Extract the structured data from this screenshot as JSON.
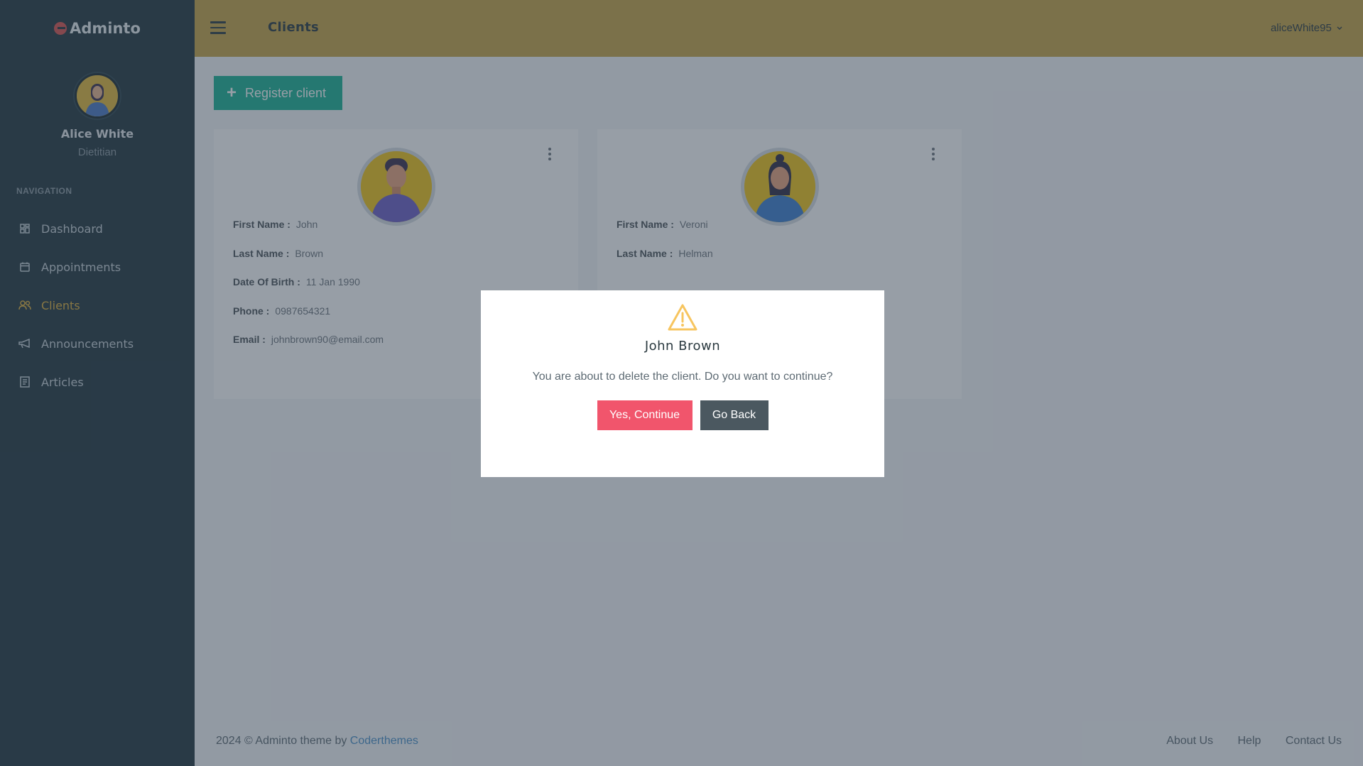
{
  "app": {
    "logo_text": "Adminto"
  },
  "user": {
    "name": "Alice White",
    "role": "Dietitian",
    "username": "aliceWhite95"
  },
  "nav": {
    "title": "NAVIGATION",
    "items": [
      {
        "label": "Dashboard",
        "icon": "grid-icon"
      },
      {
        "label": "Appointments",
        "icon": "calendar-icon"
      },
      {
        "label": "Clients",
        "icon": "users-icon",
        "active": true
      },
      {
        "label": "Announcements",
        "icon": "megaphone-icon"
      },
      {
        "label": "Articles",
        "icon": "document-icon"
      }
    ]
  },
  "header": {
    "title": "Clients"
  },
  "toolbar": {
    "register_label": "Register client",
    "register_icon": "+"
  },
  "labels": {
    "first_name": "First Name :",
    "last_name": "Last Name :",
    "dob": "Date Of Birth :",
    "phone": "Phone :",
    "email": "Email :"
  },
  "clients": [
    {
      "first_name": "John",
      "last_name": "Brown",
      "dob": "11 Jan 1990",
      "phone": "0987654321",
      "email": "johnbrown90@email.com"
    },
    {
      "first_name": "Veroni",
      "last_name": "Helman"
    }
  ],
  "modal": {
    "title": "John Brown",
    "message": "You are about to delete the client. Do you want to continue?",
    "confirm_label": "Yes, Continue",
    "cancel_label": "Go Back"
  },
  "footer": {
    "copyright_prefix": "2024 © Adminto theme by",
    "copyright_link": "Coderthemes",
    "links": [
      "About Us",
      "Help",
      "Contact Us"
    ]
  },
  "colors": {
    "sidebar": "#22363f",
    "topbar": "#c7a446",
    "accent_active": "#e1b13a",
    "primary_button": "#1ab394",
    "danger_button": "#f1556c",
    "secondary_button": "#4b5860"
  }
}
